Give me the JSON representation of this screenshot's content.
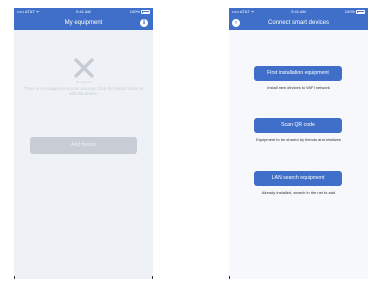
{
  "status_bar": {
    "carrier": "••••• AT&T ᯤ",
    "time": "9:41 AM",
    "battery": "100%"
  },
  "left_screen": {
    "title": "My equipment",
    "info_icon": "i",
    "empty_caption": "No equipment",
    "empty_message": "There is no equipment in your account. Click the button below to add the device.",
    "add_device_label": "Add device"
  },
  "right_screen": {
    "title": "Connect smart devices",
    "back_icon": "‹",
    "options": [
      {
        "button": "First installation equipment",
        "description": "Install new devices to WIFI network"
      },
      {
        "button": "Scan QR code",
        "description": "Equipment to be shared by friends and relatives"
      },
      {
        "button": "LAN search equipment",
        "description": "Already installed, search in the net to add"
      }
    ]
  },
  "colors": {
    "accent": "#3f6fc8",
    "empty_background": "#eef1f6",
    "disabled_button": "#c8ccd4",
    "muted_text": "#c7ccd6"
  }
}
